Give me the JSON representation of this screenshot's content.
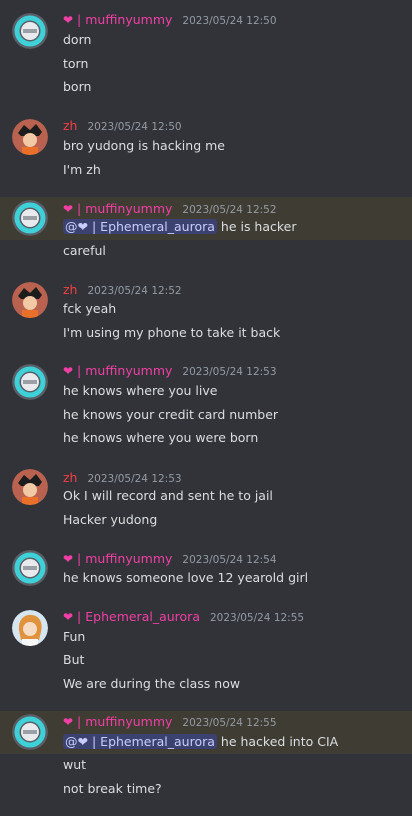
{
  "messages": [
    {
      "author": "muffinyummy",
      "heart": "❤",
      "sep": "|",
      "time": "2023/05/24 12:50",
      "lines": [
        "dorn",
        "torn",
        "born"
      ]
    },
    {
      "author": "zh",
      "time": "2023/05/24 12:50",
      "lines": [
        "bro yudong is hacking me",
        "I'm zh"
      ]
    },
    {
      "author": "muffinyummy",
      "heart": "❤",
      "sep": "|",
      "time": "2023/05/24 12:52",
      "mention": {
        "at": "@",
        "heart": "❤",
        "sep": "|",
        "name": "Ephemeral_aurora"
      },
      "mention_text": "he is hacker",
      "lines": [
        "careful"
      ]
    },
    {
      "author": "zh",
      "time": "2023/05/24 12:52",
      "lines": [
        "fck yeah",
        "I'm using my phone to take it back"
      ]
    },
    {
      "author": "muffinyummy",
      "heart": "❤",
      "sep": "|",
      "time": "2023/05/24 12:53",
      "lines": [
        "he knows where you live",
        "he knows your credit card number",
        "he knows where you were born"
      ]
    },
    {
      "author": "zh",
      "time": "2023/05/24 12:53",
      "lines": [
        "Ok I will record and sent he to jail",
        "Hacker yudong"
      ]
    },
    {
      "author": "muffinyummy",
      "heart": "❤",
      "sep": "|",
      "time": "2023/05/24 12:54",
      "lines": [
        "he knows someone love 12 yearold girl"
      ]
    },
    {
      "author": "Ephemeral_aurora",
      "heart": "❤",
      "sep": "|",
      "time": "2023/05/24 12:55",
      "lines": [
        "Fun",
        "But",
        "We are during the class now"
      ]
    },
    {
      "author": "muffinyummy",
      "heart": "❤",
      "sep": "|",
      "time": "2023/05/24 12:55",
      "mention": {
        "at": "@",
        "heart": "❤",
        "sep": "|",
        "name": "Ephemeral_aurora"
      },
      "mention_text": "he hacked into CIA",
      "lines": [
        "wut",
        "not break time?"
      ]
    }
  ],
  "colors": {
    "background": "#313338",
    "highlight": "#3f3c34",
    "name_pink": "#f23fa5",
    "name_red": "#f23f43",
    "mention_bg": "#3c4270"
  }
}
